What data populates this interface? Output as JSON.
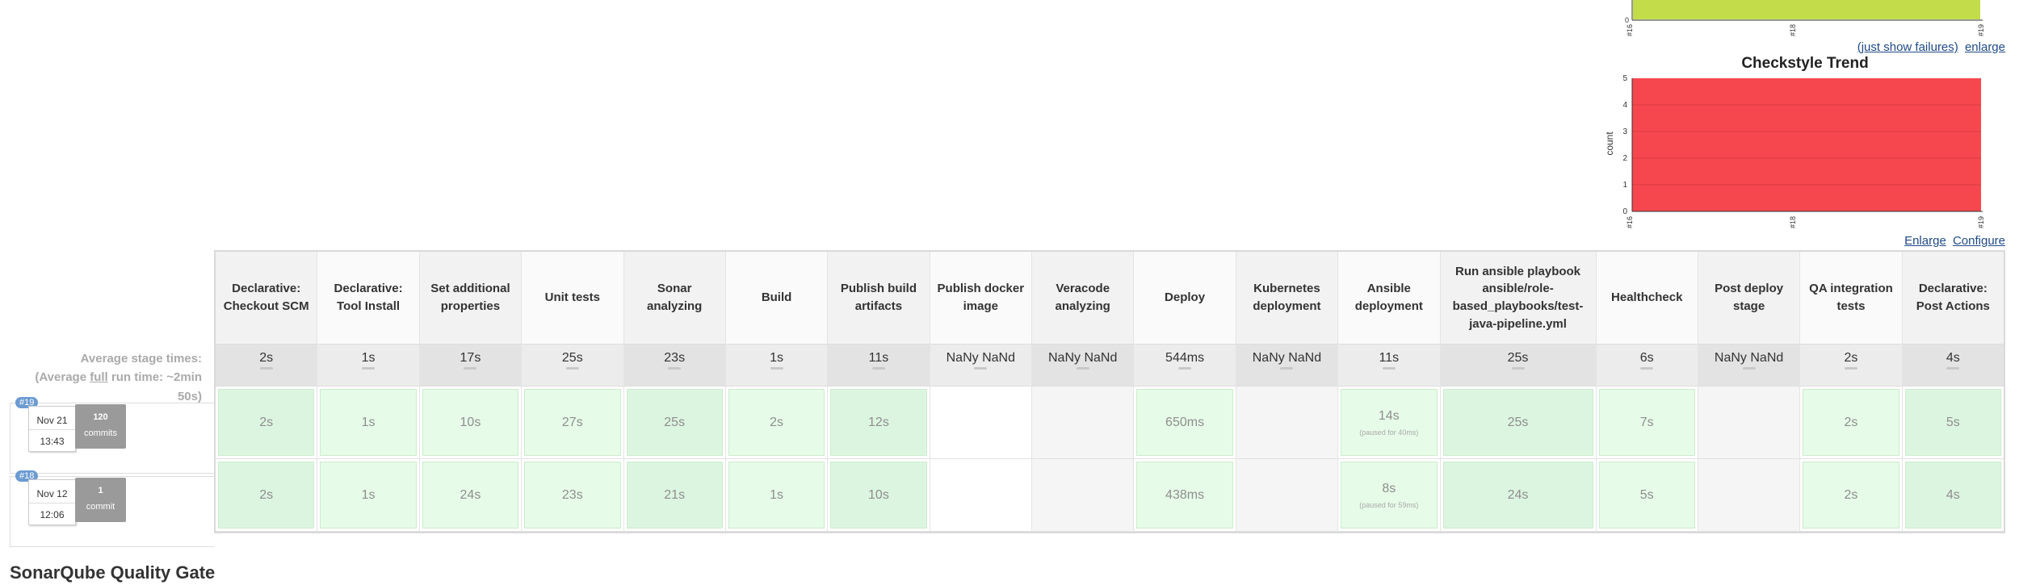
{
  "charts": {
    "top_chart": {
      "y_tick": "0",
      "x_ticks": [
        "#16",
        "#18",
        "#19"
      ],
      "bar_color": "#c3dd4a"
    },
    "top_links": {
      "failures": "(just show failures)",
      "enlarge": "enlarge"
    },
    "checkstyle": {
      "title": "Checkstyle Trend",
      "ylabel": "count",
      "y_ticks": [
        "0",
        "1",
        "2",
        "3",
        "4",
        "5"
      ],
      "x_ticks": [
        "#16",
        "#18",
        "#19"
      ],
      "fill_color": "#f6474f"
    },
    "checkstyle_links": {
      "enlarge": "Enlarge",
      "configure": "Configure"
    }
  },
  "avg_label": {
    "line1": "Average stage times:",
    "line2_pre": "(Average ",
    "line2_u": "full",
    "line2_post": " run time: ~2min",
    "line3": "50s)"
  },
  "stages": [
    {
      "name": "Declarative: Checkout SCM",
      "avg": "2s"
    },
    {
      "name": "Declarative: Tool Install",
      "avg": "1s"
    },
    {
      "name": "Set additional properties",
      "avg": "17s"
    },
    {
      "name": "Unit tests",
      "avg": "25s"
    },
    {
      "name": "Sonar analyzing",
      "avg": "23s"
    },
    {
      "name": "Build",
      "avg": "1s"
    },
    {
      "name": "Publish build artifacts",
      "avg": "11s"
    },
    {
      "name": "Publish docker image",
      "avg": "NaNy NaNd"
    },
    {
      "name": "Veracode analyzing",
      "avg": "NaNy NaNd"
    },
    {
      "name": "Deploy",
      "avg": "544ms"
    },
    {
      "name": "Kubernetes deployment",
      "avg": "NaNy NaNd"
    },
    {
      "name": "Ansible deployment",
      "avg": "11s"
    },
    {
      "name": "Run ansible playbook ansible/role-based_playbooks/test-java-pipeline.yml",
      "avg": "25s"
    },
    {
      "name": "Healthcheck",
      "avg": "6s"
    },
    {
      "name": "Post deploy stage",
      "avg": "NaNy NaNd"
    },
    {
      "name": "QA integration tests",
      "avg": "2s"
    },
    {
      "name": "Declarative: Post Actions",
      "avg": "4s"
    }
  ],
  "builds": [
    {
      "badge": "#19",
      "date": "Nov 21",
      "time": "13:43",
      "commits_count": "120",
      "commits_label": "commits",
      "cells": [
        "2s",
        "1s",
        "10s",
        "27s",
        "25s",
        "2s",
        "12s",
        "",
        "",
        "650ms",
        "",
        "14s",
        "25s",
        "7s",
        "",
        "2s",
        "5s"
      ],
      "paused": {
        "11": "(paused for 40ms)"
      }
    },
    {
      "badge": "#18",
      "date": "Nov 12",
      "time": "12:06",
      "commits_count": "1",
      "commits_label": "commit",
      "cells": [
        "2s",
        "1s",
        "24s",
        "23s",
        "21s",
        "1s",
        "10s",
        "",
        "",
        "438ms",
        "",
        "8s",
        "24s",
        "5s",
        "",
        "2s",
        "4s"
      ],
      "paused": {
        "11": "(paused for 59ms)"
      }
    }
  ],
  "sonar": {
    "title": "SonarQube Quality Gate"
  }
}
